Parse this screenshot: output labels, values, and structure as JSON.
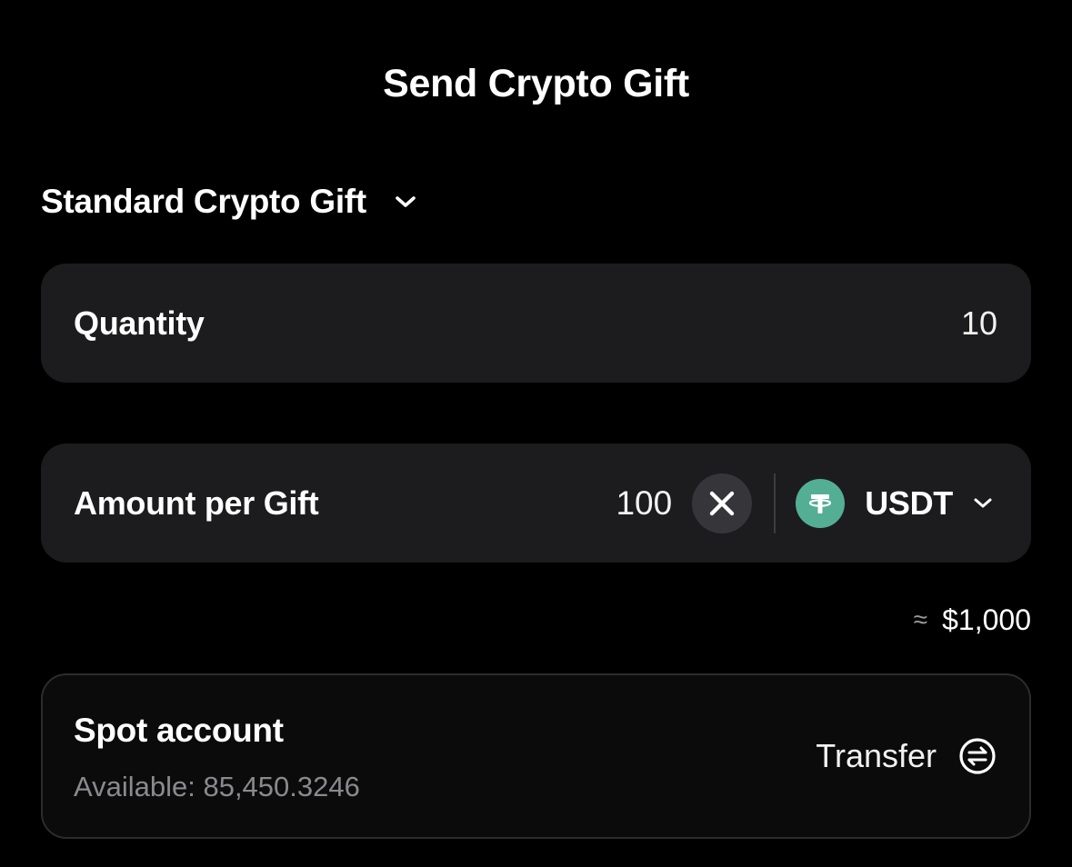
{
  "header": {
    "title": "Send Crypto Gift"
  },
  "gift_type": {
    "selected": "Standard Crypto Gift",
    "icon": "chevron-down-icon"
  },
  "quantity": {
    "label": "Quantity",
    "value": "10"
  },
  "amount": {
    "label": "Amount per Gift",
    "value": "100",
    "clear_icon": "close-icon",
    "token": {
      "symbol": "USDT",
      "icon": "tether-icon",
      "color": "#53ae94"
    }
  },
  "estimate": {
    "symbol": "≈",
    "value": "$1,000"
  },
  "spot_account": {
    "title": "Spot account",
    "available": "Available: 85,450.3246",
    "transfer_label": "Transfer",
    "transfer_icon": "transfer-icon"
  },
  "colors": {
    "background": "#000000",
    "card": "#1c1c1e",
    "muted_text": "#8a8a8e",
    "accent_token": "#53ae94"
  }
}
